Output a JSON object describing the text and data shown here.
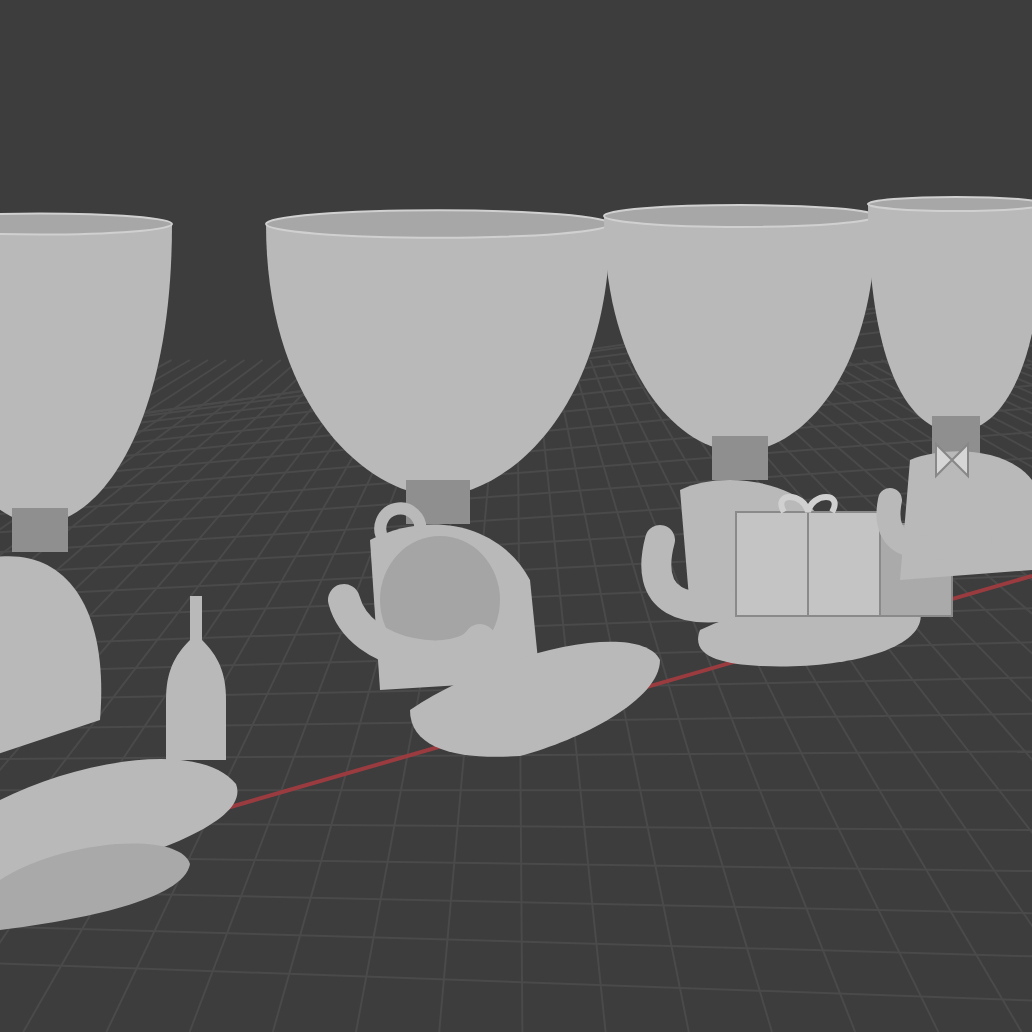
{
  "viewport": {
    "axis": {
      "kind": "x"
    },
    "models": [
      {
        "kind": "bottle"
      },
      {
        "kind": "kettle"
      },
      {
        "kind": "gift"
      },
      {
        "kind": "bow"
      }
    ]
  }
}
